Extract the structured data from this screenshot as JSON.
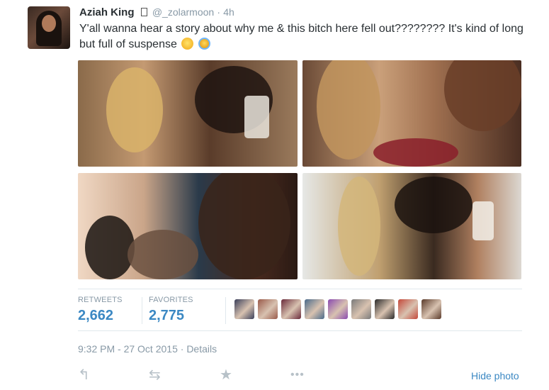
{
  "tweet": {
    "display_name": "Aziah King",
    "verified_glyph": "▯",
    "handle": "@_zolarmoon",
    "separator": "·",
    "relative_time": "4h",
    "text": "Y'all wanna hear a story about why me & this bitch here fell out???????? It's kind of long but full of suspense",
    "emoji": [
      "face-with-tears-of-joy",
      "loudly-crying-face"
    ]
  },
  "media": {
    "photos": [
      {
        "name": "photo-1"
      },
      {
        "name": "photo-2"
      },
      {
        "name": "photo-3"
      },
      {
        "name": "photo-4"
      }
    ]
  },
  "stats": {
    "retweets_label": "RETWEETS",
    "retweets_value": "2,662",
    "favorites_label": "FAVORITES",
    "favorites_value": "2,775"
  },
  "favoriters": {
    "count_shown": 9,
    "colors": [
      "#3a3f5a",
      "#9a5a4a",
      "#6a2a3a",
      "#4a6a8a",
      "#8a4ab0",
      "#7a7a7a",
      "#2a2a2a",
      "#c4483a",
      "#5a3a2a"
    ]
  },
  "footer": {
    "timestamp": "9:32 PM - 27 Oct 2015",
    "separator": "·",
    "details_label": "Details",
    "hide_photo_label": "Hide photo"
  },
  "actions": {
    "reply_icon": "reply-icon",
    "retweet_icon": "retweet-icon",
    "favorite_icon": "star-icon",
    "more_icon": "more-dots-icon",
    "reply_glyph": "↰",
    "retweet_glyph": "⇆",
    "favorite_glyph": "★",
    "more_glyph": "•••"
  },
  "colors": {
    "link_blue": "#3b88c3",
    "muted_gray": "#8899a6",
    "icon_gray": "#b7c1c8",
    "divider": "#e1e8ed"
  }
}
